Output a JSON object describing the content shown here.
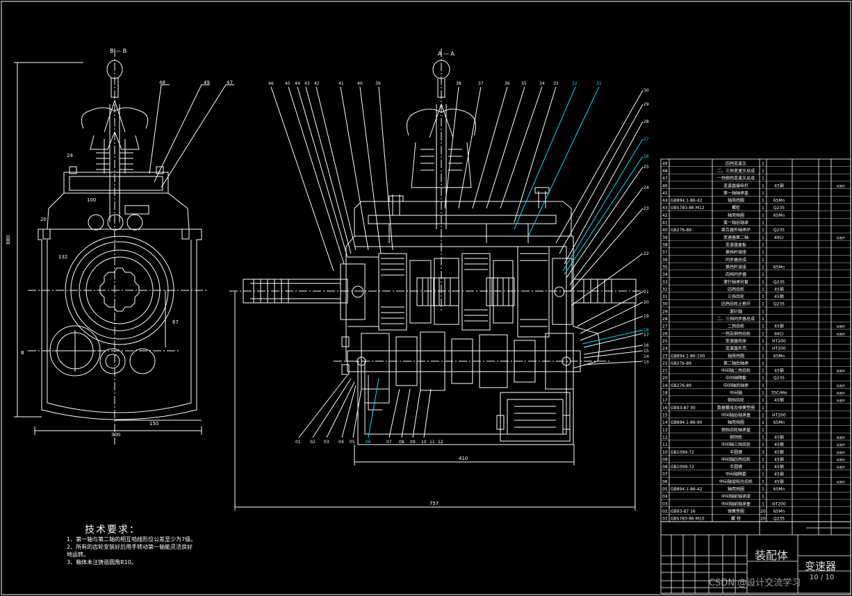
{
  "notes": {
    "title": "技术要求：",
    "items": [
      "1、第一轴与第二轴的相互啮线形位公差至少为7级。",
      "2、所有的齿轮安装好后用手转动第一轴能灵活良好",
      "地运转。",
      "3、箱体未注铸造圆角R10。"
    ]
  },
  "title_block": {
    "drawing_title": "装配体",
    "part_name": "变速器",
    "sheet": "10 / 10"
  },
  "watermark": "CSDN @设计交流学习",
  "dimensions": {
    "height_left": "880",
    "width_left_bottom": "300",
    "offset_left_bottom": "150",
    "left_top": "100",
    "width_middle": "410",
    "width_overall": "757",
    "left_small_a": "24",
    "left_small_b": "67",
    "left_small_c": "132",
    "left_small_d": "20"
  },
  "section_marks": {
    "left_top": "B — B",
    "center_top": "A — A"
  },
  "balloons": {
    "left_view": [
      "48",
      "49",
      "47"
    ],
    "center_top": [
      "46",
      "45",
      "44",
      "43",
      "42",
      "41",
      "40",
      "39",
      "38",
      "37",
      "36",
      "35",
      "34",
      "33",
      "32",
      "31"
    ],
    "right_side": [
      "30",
      "29",
      "28",
      "27",
      "26",
      "25",
      "24",
      "23",
      "22",
      "21",
      "20",
      "19",
      "18",
      "17",
      "16",
      "15",
      "14",
      "13"
    ],
    "bottom": [
      "01",
      "02",
      "03",
      "04",
      "05",
      "06",
      "07",
      "08",
      "09",
      "10",
      "11",
      "12"
    ]
  },
  "parts_list": [
    {
      "no": "49",
      "std": "",
      "name": "四挡变速叉",
      "qty": "1",
      "mat": "",
      "note": ""
    },
    {
      "no": "48",
      "std": "",
      "name": "二、三挡变速叉总成",
      "qty": "1",
      "mat": "",
      "note": ""
    },
    {
      "no": "47",
      "std": "",
      "name": "一挡倒挡变速叉总成",
      "qty": "1",
      "mat": "",
      "note": ""
    },
    {
      "no": "46",
      "std": "",
      "name": "变速器操纵杆",
      "qty": "1",
      "mat": "45钢",
      "note": "标准件"
    },
    {
      "no": "45",
      "std": "",
      "name": "第一轴轴承盖",
      "qty": "1",
      "mat": "",
      "note": ""
    },
    {
      "no": "44",
      "std": "GB894.1-86-42",
      "name": "轴用挡圈",
      "qty": "1",
      "mat": "65Mn",
      "note": ""
    },
    {
      "no": "43",
      "std": "GB5783-86 M12",
      "name": "螺栓",
      "qty": "1",
      "mat": "Q235",
      "note": ""
    },
    {
      "no": "42",
      "std": "",
      "name": "轴用挡圈",
      "qty": "1",
      "mat": "65Mn",
      "note": ""
    },
    {
      "no": "41",
      "std": "",
      "name": "第一轴后轴承",
      "qty": "1",
      "mat": "",
      "note": ""
    },
    {
      "no": "40",
      "std": "GB276-89",
      "name": "离合器外轴承环",
      "qty": "1",
      "mat": "Q235",
      "note": ""
    },
    {
      "no": "39",
      "std": "",
      "name": "变速器第二轴",
      "qty": "1",
      "mat": "40Cr",
      "note": "标准件"
    },
    {
      "no": "38",
      "std": "",
      "name": "变速器盖板",
      "qty": "1",
      "mat": "",
      "note": ""
    },
    {
      "no": "37",
      "std": "",
      "name": "换挡杆球座",
      "qty": "1",
      "mat": "",
      "note": ""
    },
    {
      "no": "36",
      "std": "",
      "name": "同步器总成",
      "qty": "1",
      "mat": "",
      "note": ""
    },
    {
      "no": "35",
      "std": "",
      "name": "换挡杆球座",
      "qty": "1",
      "mat": "65Mn",
      "note": ""
    },
    {
      "no": "34",
      "std": "",
      "name": "四挡同步器",
      "qty": "1",
      "mat": "",
      "note": ""
    },
    {
      "no": "33",
      "std": "",
      "name": "滚针轴承衬套",
      "qty": "1",
      "mat": "Q235",
      "note": ""
    },
    {
      "no": "32",
      "std": "",
      "name": "四挡齿轮",
      "qty": "1",
      "mat": "45钢",
      "note": ""
    },
    {
      "no": "31",
      "std": "",
      "name": "三挡齿轮",
      "qty": "1",
      "mat": "45钢",
      "note": ""
    },
    {
      "no": "30",
      "std": "",
      "name": "四挡齿轮止推环",
      "qty": "1",
      "mat": "Q235",
      "note": ""
    },
    {
      "no": "29",
      "std": "",
      "name": "滚针轴",
      "qty": "1",
      "mat": "",
      "note": ""
    },
    {
      "no": "28",
      "std": "",
      "name": "二、三挡同步器总成",
      "qty": "1",
      "mat": "",
      "note": ""
    },
    {
      "no": "27",
      "std": "",
      "name": "二挡齿轮",
      "qty": "1",
      "mat": "45钢",
      "note": "标准件"
    },
    {
      "no": "26",
      "std": "",
      "name": "一挡及倒挡齿轮",
      "qty": "1",
      "mat": "40Cr",
      "note": "标准件"
    },
    {
      "no": "25",
      "std": "",
      "name": "变速器壳体",
      "qty": "1",
      "mat": "HT200",
      "note": ""
    },
    {
      "no": "24",
      "std": "",
      "name": "变速器外壳",
      "qty": "1",
      "mat": "HT200",
      "note": ""
    },
    {
      "no": "23",
      "std": "GB894.1-86-100",
      "name": "轴用挡圈",
      "qty": "1",
      "mat": "65Mn",
      "note": ""
    },
    {
      "no": "22",
      "std": "GB276-89",
      "name": "第二轴后轴承",
      "qty": "1",
      "mat": "",
      "note": ""
    },
    {
      "no": "21",
      "std": "",
      "name": "中间轴二挡齿轮",
      "qty": "1",
      "mat": "45钢",
      "note": "标准件"
    },
    {
      "no": "20",
      "std": "",
      "name": "中间轴隔套",
      "qty": "1",
      "mat": "Q235",
      "note": ""
    },
    {
      "no": "19",
      "std": "GB276-89",
      "name": "中间轴后轴承",
      "qty": "1",
      "mat": "",
      "note": "标准件"
    },
    {
      "no": "18",
      "std": "",
      "name": "中间轴",
      "qty": "1",
      "mat": "35CrMo",
      "note": "标准件"
    },
    {
      "no": "17",
      "std": "",
      "name": "倒挡齿轮",
      "qty": "1",
      "mat": "45钢",
      "note": "标准件"
    },
    {
      "no": "16",
      "std": "GB93-87 30",
      "name": "数据螺母及弹簧垫圈",
      "qty": "1",
      "mat": "",
      "note": ""
    },
    {
      "no": "15",
      "std": "",
      "name": "中间轴后轴承盖",
      "qty": "1",
      "mat": "HT200",
      "note": ""
    },
    {
      "no": "14",
      "std": "GB894.1-86-90",
      "name": "轴用挡圈",
      "qty": "1",
      "mat": "65Mn",
      "note": ""
    },
    {
      "no": "13",
      "std": "",
      "name": "倒挡齿轮轴承盖",
      "qty": "1",
      "mat": "",
      "note": ""
    },
    {
      "no": "12",
      "std": "",
      "name": "倒挡轮",
      "qty": "1",
      "mat": "45钢",
      "note": "标准件"
    },
    {
      "no": "11",
      "std": "",
      "name": "中间轴三挡齿轮",
      "qty": "1",
      "mat": "45钢",
      "note": "标准件"
    },
    {
      "no": "10",
      "std": "GB1099-72",
      "name": "半圆键",
      "qty": "3",
      "mat": "45钢",
      "note": "标准件"
    },
    {
      "no": "09",
      "std": "",
      "name": "中间轴四挡齿轮",
      "qty": "1",
      "mat": "45钢",
      "note": "标准件"
    },
    {
      "no": "08",
      "std": "GB1099-72",
      "name": "半圆键",
      "qty": "1",
      "mat": "45钢",
      "note": "标准件"
    },
    {
      "no": "07",
      "std": "",
      "name": "中间轴隔套",
      "qty": "1",
      "mat": "45钢",
      "note": ""
    },
    {
      "no": "06",
      "std": "",
      "name": "中间轴常啮合齿轮",
      "qty": "1",
      "mat": "45钢",
      "note": "标准件"
    },
    {
      "no": "05",
      "std": "GB894.1-86-42",
      "name": "轴用挡圈",
      "qty": "1",
      "mat": "65Mn",
      "note": ""
    },
    {
      "no": "04",
      "std": "",
      "name": "中间轴前轴承座",
      "qty": "1",
      "mat": "",
      "note": ""
    },
    {
      "no": "03",
      "std": "",
      "name": "中间轴前轴承盖",
      "qty": "1",
      "mat": "HT200",
      "note": ""
    },
    {
      "no": "02",
      "std": "GB93-87 16",
      "name": "弹簧垫圈",
      "qty": "20",
      "mat": "65Mn",
      "note": ""
    },
    {
      "no": "01",
      "std": "GB5783-86 M10",
      "name": "螺 栓",
      "qty": "20",
      "mat": "Q235",
      "note": ""
    }
  ],
  "colors": {
    "line": "#ffffff",
    "leader_highlight": "#00e5ff",
    "background": "#000000"
  }
}
